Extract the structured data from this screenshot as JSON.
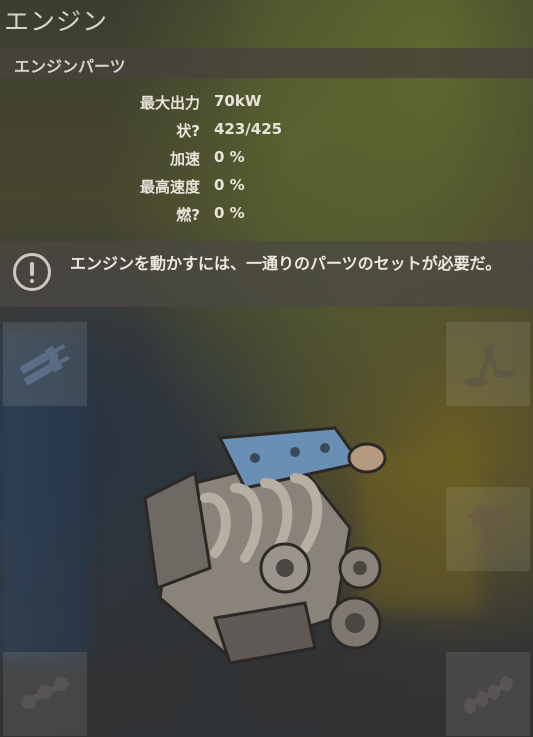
{
  "window": {
    "title": "エンジン"
  },
  "parts_header": {
    "label": "エンジンパーツ"
  },
  "stats": [
    {
      "label": "最大出力",
      "value": "70kW"
    },
    {
      "label": "状?",
      "value": "423/425"
    },
    {
      "label": "加速",
      "value": "0 %"
    },
    {
      "label": "最高速度",
      "value": "0 %"
    },
    {
      "label": "燃?",
      "value": "0 %"
    }
  ],
  "warning": {
    "icon": "exclamation-circle-icon",
    "text": "エンジンを動かすには、一通りのパーツのセットが必要だ。"
  },
  "slots": [
    {
      "icon": "spark-plug-icon"
    },
    {
      "icon": "valve-icon"
    },
    {
      "icon": "piston-icon"
    },
    {
      "icon": "crankshaft-icon"
    },
    {
      "icon": "camshaft-icon"
    }
  ],
  "engine_item": {
    "icon": "car-engine-icon"
  }
}
